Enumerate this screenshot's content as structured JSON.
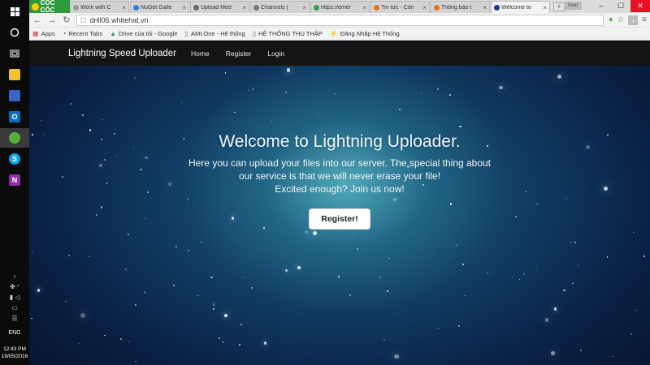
{
  "taskbar": {
    "start_icon": "windows-logo",
    "apps": [
      "search",
      "task-view",
      "file-explorer",
      "floppy-save",
      "outlook",
      "coc-coc-browser",
      "skype",
      "onenote"
    ],
    "tray": {
      "language": "ENG",
      "time": "12:43 PM",
      "date": "19/05/2016"
    }
  },
  "browser": {
    "brand": "CỐC CỐC",
    "tabs": [
      {
        "title": "Work with C",
        "color": "#9a9a9a"
      },
      {
        "title": "NuGet Galle",
        "color": "#2f7fd6"
      },
      {
        "title": "Upload Med",
        "color": "#6b6b6b"
      },
      {
        "title": "Channels |",
        "color": "#777777"
      },
      {
        "title": "https://emer",
        "color": "#3b9b4a"
      },
      {
        "title": "Tin tức - Côn",
        "color": "#e8731a"
      },
      {
        "title": "Thông báo t",
        "color": "#e8731a"
      },
      {
        "title": "Welcome to",
        "color": "#1a3c7a"
      }
    ],
    "active_tab_index": 7,
    "user_label": "User",
    "url": "drill06.whitehat.vn",
    "bookmarks": [
      "Apps",
      "Recent Tabs",
      "Drive của tôi - Google",
      "AMI.One - Hệ thống",
      "HỆ THỐNG THU THẬP",
      "Đăng Nhập Hệ Thống"
    ]
  },
  "page": {
    "navbar": {
      "brand": "Lightning Speed Uploader",
      "links": [
        "Home",
        "Register",
        "Login"
      ]
    },
    "hero": {
      "title": "Welcome to Lightning Uploader.",
      "line1": "Here you can upload your files into our server. The special thing about",
      "line2": "our service is that we will never erase your file!",
      "line3": "Excited enough? Join us now!",
      "button": "Register!"
    }
  }
}
